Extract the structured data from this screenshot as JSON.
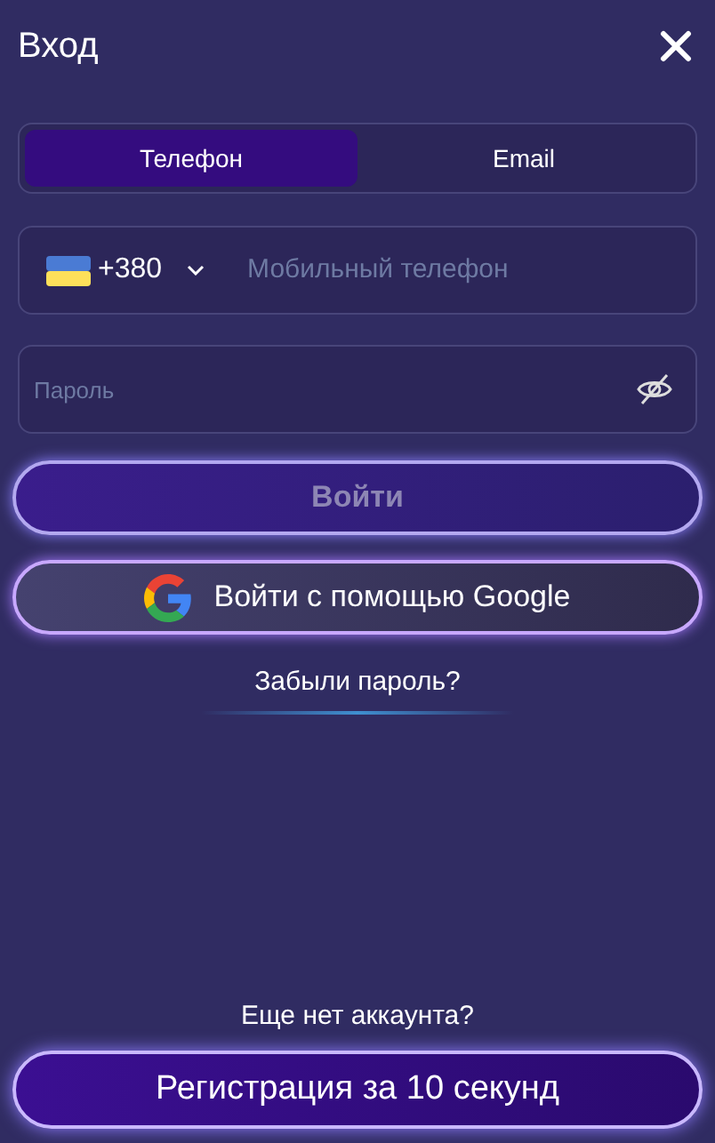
{
  "header": {
    "title": "Вход"
  },
  "tabs": [
    {
      "label": "Телефон",
      "selected": true
    },
    {
      "label": "Email",
      "selected": false
    }
  ],
  "phone": {
    "country_code": "+380",
    "placeholder": "Мобильный телефон"
  },
  "password": {
    "placeholder": "Пароль"
  },
  "login_button": {
    "label": "Войти",
    "disabled": true
  },
  "google_button": {
    "label": "Войти с помощью Google"
  },
  "forgot_link": "Забыли пароль?",
  "signup_prompt": "Еще нет аккаунта?",
  "signup_button": "Регистрация за 10 секунд"
}
